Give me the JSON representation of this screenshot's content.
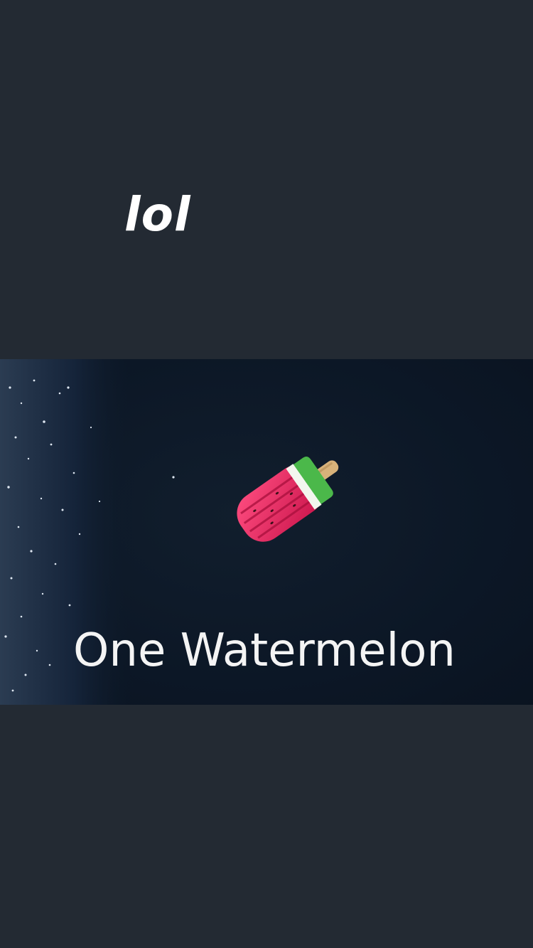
{
  "story": {
    "caption": "lol",
    "video": {
      "title": "One Watermelon",
      "subject_icon": "watermelon-popsicle-float-icon"
    }
  },
  "colors": {
    "background": "#232a33",
    "video_water": "#0c1826",
    "caption_text": "#ffffff",
    "title_text": "#f4f4f4",
    "float_pink": "#e8265a",
    "float_rind": "#4bb84a",
    "float_stick": "#d8b27a"
  }
}
